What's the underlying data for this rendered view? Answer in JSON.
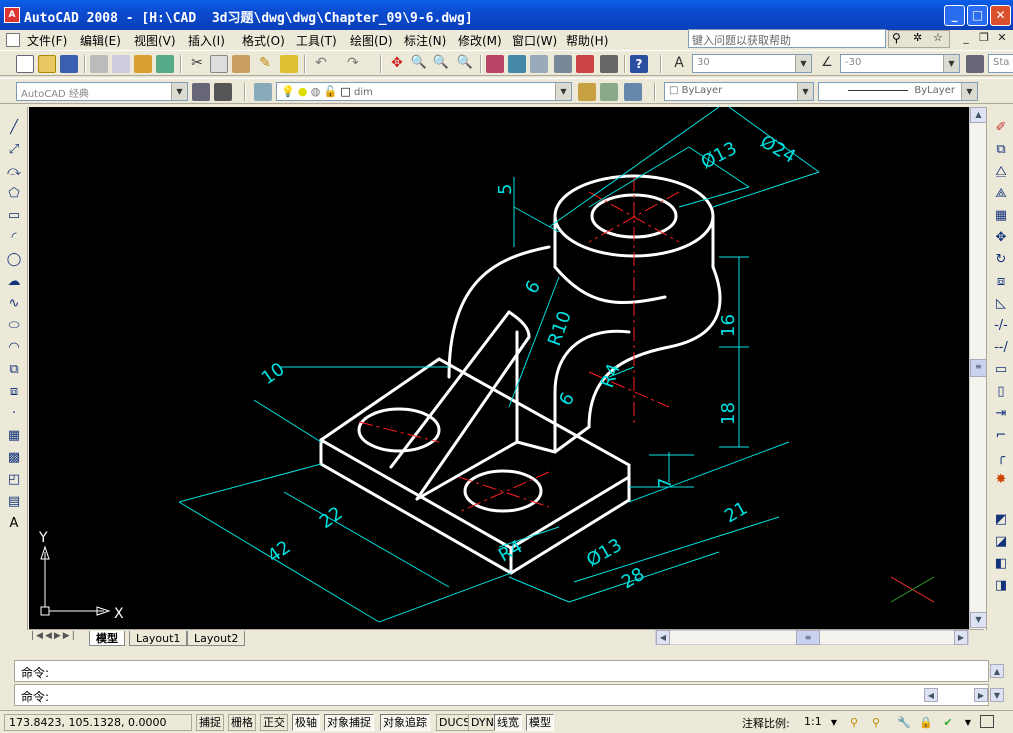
{
  "window": {
    "title": "AutoCAD 2008 - [H:\\CAD  3d习题\\dwg\\dwg\\Chapter_09\\9-6.dwg]",
    "app_icon_text": "A",
    "minimize": "_",
    "maximize": "□",
    "close": "✕"
  },
  "menu": [
    {
      "label": "文件(F)"
    },
    {
      "label": "编辑(E)"
    },
    {
      "label": "视图(V)"
    },
    {
      "label": "插入(I)"
    },
    {
      "label": "格式(O)"
    },
    {
      "label": "工具(T)"
    },
    {
      "label": "绘图(D)"
    },
    {
      "label": "标注(N)"
    },
    {
      "label": "修改(M)"
    },
    {
      "label": "窗口(W)"
    },
    {
      "label": "帮助(H)"
    }
  ],
  "help_search": {
    "placeholder": "键入问题以获取帮助"
  },
  "mdi": {
    "minimize": "_",
    "restore": "❐",
    "close": "✕"
  },
  "toolbar": {
    "text_height": "30",
    "angle": "-30",
    "style_truncated": "Sta",
    "workspace": "AutoCAD 经典",
    "layer": "dim",
    "color": "ByLayer",
    "linetype": "ByLayer"
  },
  "tabs": {
    "model": "模型",
    "layout1": "Layout1",
    "layout2": "Layout2"
  },
  "ucs": {
    "x_label": "X",
    "y_label": "Y"
  },
  "drawing": {
    "dimensions": [
      "Ø24",
      "Ø13",
      "5",
      "6",
      "R10",
      "16",
      "R4",
      "18",
      "10",
      "6",
      "7",
      "22",
      "42",
      "R4",
      "Ø13",
      "28",
      "21"
    ]
  },
  "command": {
    "line1": "命令:",
    "line2": "命令:"
  },
  "status": {
    "coordinates": "173.8423, 105.1328, 0.0000",
    "buttons": [
      {
        "label": "捕捉",
        "on": false
      },
      {
        "label": "栅格",
        "on": false
      },
      {
        "label": "正交",
        "on": false
      },
      {
        "label": "极轴",
        "on": true
      },
      {
        "label": "对象捕捉",
        "on": true
      },
      {
        "label": "对象追踪",
        "on": true
      },
      {
        "label": "DUCS",
        "on": false
      },
      {
        "label": "DYN",
        "on": false
      },
      {
        "label": "线宽",
        "on": true
      },
      {
        "label": "模型",
        "on": true
      }
    ],
    "annotation_scale_label": "注释比例:",
    "annotation_scale": "1:1"
  },
  "colors": {
    "canvas_bg": "#000000",
    "geometry": "#ffffff",
    "dimensions": "#00ffff",
    "centerlines": "#ff0000",
    "titlebar": "#0b4bd0"
  }
}
